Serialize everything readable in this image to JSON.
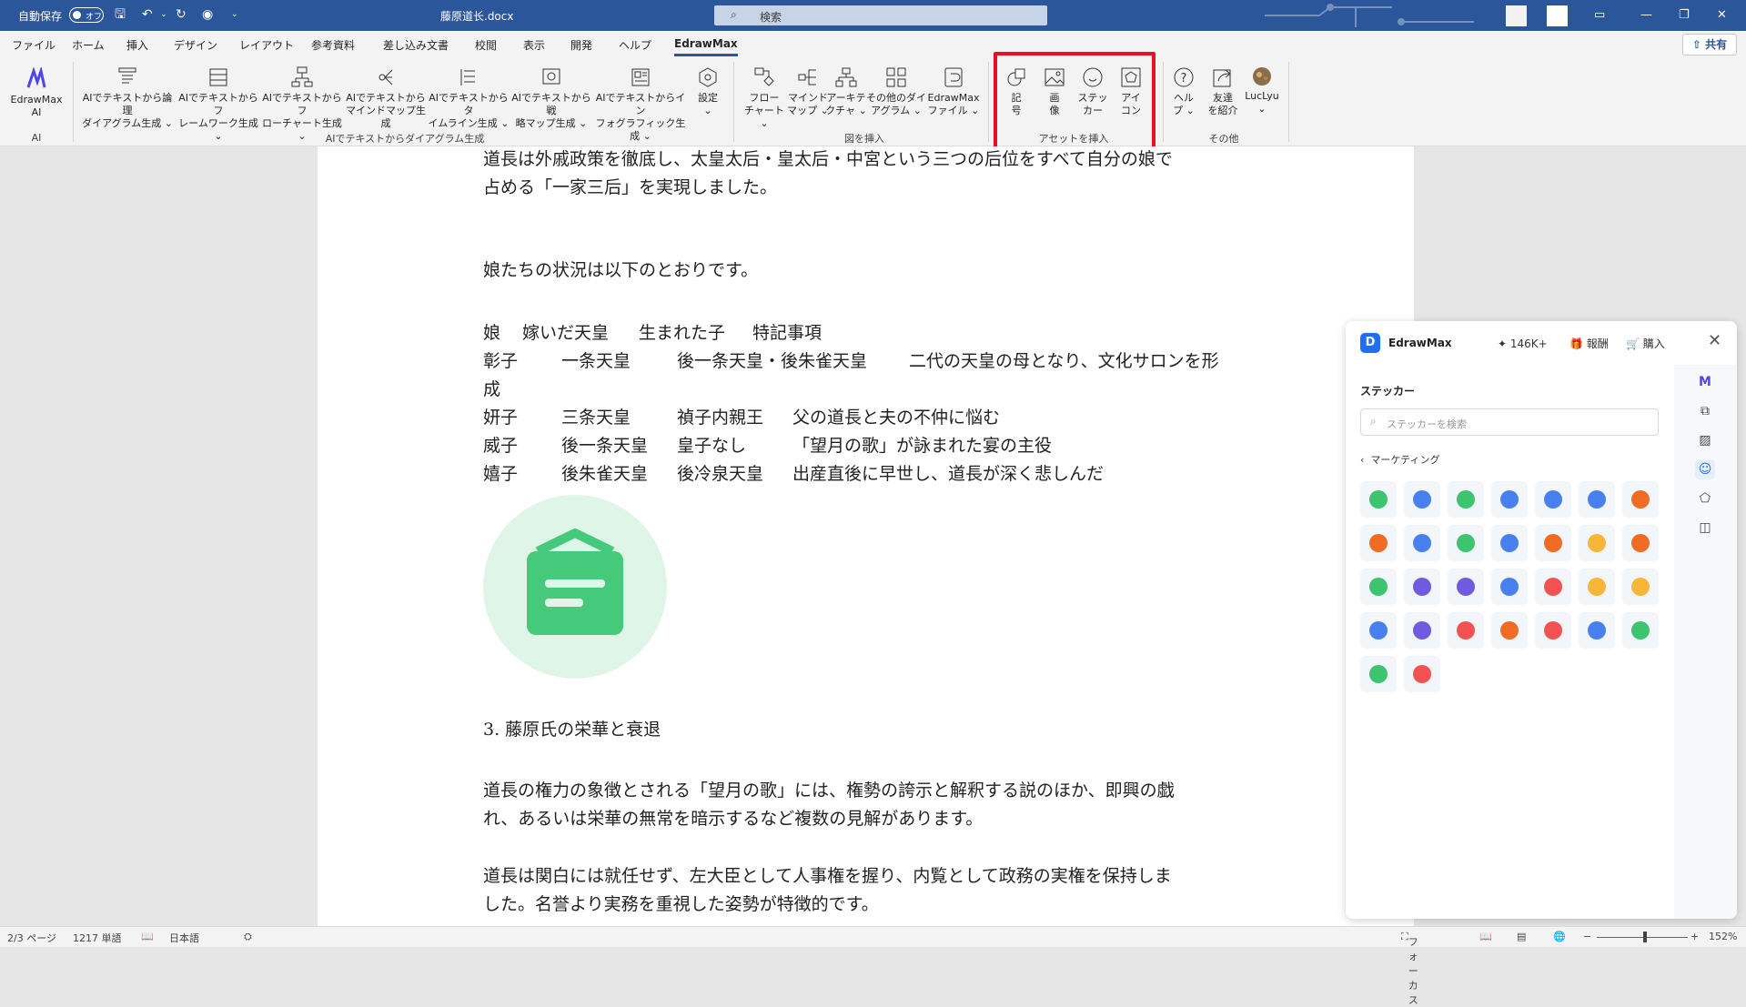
{
  "titlebar": {
    "autosave_label": "自動保存",
    "autosave_state": "オフ",
    "doc_title": "藤原道长.docx",
    "search_placeholder": "検索"
  },
  "menus": [
    "ファイル",
    "ホーム",
    "挿入",
    "デザイン",
    "レイアウト",
    "参考資料",
    "差し込み文書",
    "校閲",
    "表示",
    "開発",
    "ヘルプ",
    "EdrawMax"
  ],
  "share_label": "共有",
  "ribbon": {
    "ai_btn": [
      "EdrawMax",
      "AI"
    ],
    "ai_group": "AI",
    "textgen": [
      [
        "AIでテキストから論理",
        "ダイアグラム生成 ⌄"
      ],
      [
        "AIでテキストからフ",
        "レームワーク生成 ⌄"
      ],
      [
        "AIでテキストからフ",
        "ローチャート生成 ⌄"
      ],
      [
        "AIでテキストから",
        "マインドマップ生成"
      ],
      [
        "AIでテキストからタ",
        "イムライン生成 ⌄"
      ],
      [
        "AIでテキストから戦",
        "略マップ生成 ⌄"
      ],
      [
        "AIでテキストからイン",
        "フォグラフィック生成 ⌄"
      ],
      [
        "設定",
        "⌄"
      ]
    ],
    "textgen_group": "AIでテキストからダイアグラム生成",
    "insert": [
      [
        "フロー",
        "チャート ⌄"
      ],
      [
        "マインド",
        "マップ ⌄"
      ],
      [
        "アーキテ",
        "クチャ ⌄"
      ],
      [
        "その他のダイ",
        "アグラム ⌄"
      ],
      [
        "EdrawMax",
        "ファイル ⌄"
      ]
    ],
    "insert_group": "図を挿入",
    "assets": [
      [
        "記",
        "号"
      ],
      [
        "画",
        "像"
      ],
      [
        "ステッ",
        "カー"
      ],
      [
        "アイ",
        "コン"
      ]
    ],
    "assets_group": "アセットを挿入",
    "other": [
      [
        "ヘル",
        "プ ⌄"
      ],
      [
        "友達",
        "を紹介"
      ],
      [
        "LucLyu",
        "⌄"
      ]
    ],
    "other_group": "その他"
  },
  "document": {
    "p1a": "道長は外戚政策を徹底し、太皇太后・皇太后・中宮という三つの后位をすべて自分の娘で",
    "p1b": "占める「一家三后」を実現しました。",
    "p2": "娘たちの状況は以下のとおりです。",
    "table": [
      [
        "娘",
        "嫁いだ天皇",
        "生まれた子",
        "特記事項"
      ],
      [
        "彰子",
        "一条天皇",
        "後一条天皇・後朱雀天皇",
        "二代の天皇の母となり、文化サロンを形"
      ],
      [
        "成",
        "",
        "",
        ""
      ],
      [
        "妍子",
        "三条天皇",
        "禎子内親王",
        "父の道長と夫の不仲に悩む"
      ],
      [
        "威子",
        "後一条天皇",
        "皇子なし",
        "「望月の歌」が詠まれた宴の主役"
      ],
      [
        "嬉子",
        "後朱雀天皇",
        "後冷泉天皇",
        "出産直後に早世し、道長が深く悲しんだ"
      ]
    ],
    "heading3": "3.  藤原氏の栄華と衰退",
    "p3a": "道長の権力の象徴とされる「望月の歌」には、権勢の誇示と解釈する説のほか、即興の戯",
    "p3b": "れ、あるいは栄華の無常を暗示するなど複数の見解があります。",
    "p4a": "道長は関白には就任せず、左大臣として人事権を握り、内覧として政務の実権を保持しま",
    "p4b": "した。名誉より実務を重視した姿勢が特徴的です。"
  },
  "panel": {
    "brand": "EdrawMax",
    "credits": "146K+",
    "reward": "報酬",
    "buy": "購入",
    "section": "ステッカー",
    "search_placeholder": "ステッカーを検索",
    "category": "マーケティング",
    "sticker_colors": [
      "#3cc46e",
      "#4a7ff0",
      "#3cc46e",
      "#4a7ff0",
      "#4a7ff0",
      "#4a7ff0",
      "#f26b22",
      "#f26b22",
      "#4a7ff0",
      "#3cc46e",
      "#4a7ff0",
      "#f26b22",
      "#f5b63a",
      "#f26b22",
      "#3cc46e",
      "#6f5ae0",
      "#6f5ae0",
      "#4a7ff0",
      "#f25252",
      "#f5b63a",
      "#f5b63a",
      "#4a7ff0",
      "#6f5ae0",
      "#f25252",
      "#f26b22",
      "#f25252",
      "#4a7ff0",
      "#3cc46e",
      "#3cc46e",
      "#f25252"
    ]
  },
  "status": {
    "page": "2/3 ページ",
    "words": "1217 単語",
    "lang": "日本語",
    "focus": "フォーカス",
    "zoom": "152%"
  },
  "colors": {
    "titlebar": "#2b579a",
    "highlight": "#e81123",
    "sticker_green": "#45c97a",
    "sticker_bg": "#dff5e8"
  }
}
